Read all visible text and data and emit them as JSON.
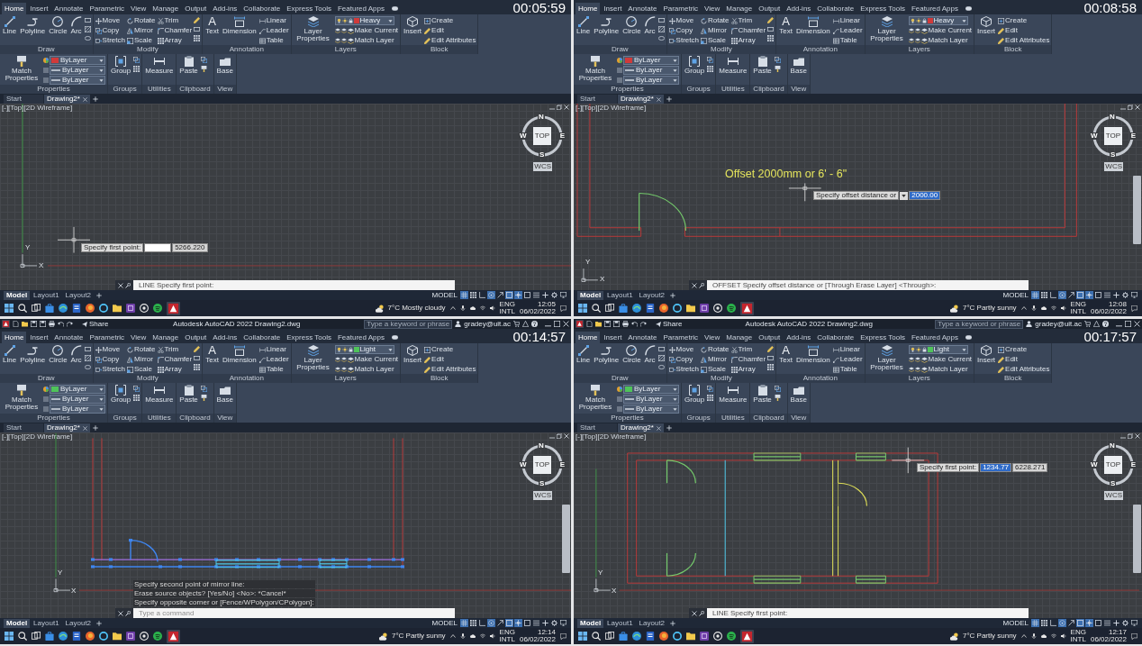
{
  "screens": [
    {
      "timestamp": "00:05:59",
      "ribbon_tabs": [
        {
          "label": "Home",
          "selected": true
        },
        {
          "label": "Insert",
          "selected": false
        },
        {
          "label": "Annotate",
          "selected": false
        },
        {
          "label": "Parametric",
          "selected": false
        },
        {
          "label": "View",
          "selected": false
        },
        {
          "label": "Manage",
          "selected": false
        },
        {
          "label": "Output",
          "selected": false
        },
        {
          "label": "Add-ins",
          "selected": false
        },
        {
          "label": "Collaborate",
          "selected": false
        },
        {
          "label": "Express Tools",
          "selected": false
        },
        {
          "label": "Featured Apps",
          "selected": false
        }
      ],
      "panels": [
        {
          "label": "Draw",
          "tools": [
            {
              "kind": "large",
              "label": "Line"
            },
            {
              "kind": "large",
              "label": "Polyline"
            },
            {
              "kind": "large",
              "label": "Circle"
            },
            {
              "kind": "large",
              "label": "Arc"
            }
          ]
        },
        {
          "label": "Modify",
          "tools": [
            {
              "kind": "small",
              "label": "Move"
            },
            {
              "kind": "small",
              "label": "Copy"
            },
            {
              "kind": "small",
              "label": "Stretch"
            },
            {
              "kind": "small",
              "label": "Rotate"
            },
            {
              "kind": "small",
              "label": "Mirror"
            },
            {
              "kind": "small",
              "label": "Scale"
            },
            {
              "kind": "small",
              "label": "Trim"
            },
            {
              "kind": "small",
              "label": "Chamfer"
            },
            {
              "kind": "small",
              "label": "Array"
            }
          ]
        },
        {
          "label": "Annotation",
          "tools": [
            {
              "kind": "large",
              "label": "Text",
              "glyph": "A"
            },
            {
              "kind": "large",
              "label": "Dimension"
            },
            {
              "kind": "small",
              "label": "Linear"
            },
            {
              "kind": "small",
              "label": "Leader"
            },
            {
              "kind": "small",
              "label": "Table"
            }
          ]
        },
        {
          "label": "Layers",
          "tools": [
            {
              "kind": "large",
              "label": "Layer Properties"
            },
            {
              "kind": "layer",
              "label": "Heavy",
              "color": "#d03a3a"
            },
            {
              "kind": "small",
              "label": "Make Current"
            },
            {
              "kind": "small",
              "label": "Match Layer"
            }
          ]
        },
        {
          "label": "Block",
          "tools": [
            {
              "kind": "large",
              "label": "Insert"
            },
            {
              "kind": "small",
              "label": "Create"
            },
            {
              "kind": "small",
              "label": "Edit"
            },
            {
              "kind": "small",
              "label": "Edit Attributes"
            }
          ]
        },
        {
          "label": "Properties",
          "tools": [
            {
              "kind": "large",
              "label": "Match Properties"
            },
            {
              "kind": "property",
              "label": "ByLayer",
              "color": "#d03a3a"
            },
            {
              "kind": "property",
              "label": "ByLayer"
            },
            {
              "kind": "property",
              "label": "ByLayer"
            }
          ]
        },
        {
          "label": "Groups",
          "tools": [
            {
              "kind": "large",
              "label": "Group"
            }
          ]
        },
        {
          "label": "Utilities",
          "tools": [
            {
              "kind": "large",
              "label": "Measure"
            }
          ]
        },
        {
          "label": "Clipboard",
          "tools": [
            {
              "kind": "large",
              "label": "Paste"
            }
          ]
        },
        {
          "label": "View",
          "tools": [
            {
              "kind": "large",
              "label": "Base"
            }
          ]
        }
      ],
      "file_tabs": [
        {
          "label": "Start",
          "selected": false
        },
        {
          "label": "Drawing2*",
          "selected": true
        }
      ],
      "viewport_label": "[-][Top][2D Wireframe]",
      "viewcube": {
        "face": "TOP",
        "north": "N",
        "south": "S",
        "east": "E",
        "west": "W",
        "ucs": "WCS"
      },
      "navigation_bar": false,
      "ucs_icon": {
        "x": "X",
        "y": "Y"
      },
      "kind": "blank",
      "tooltip": {
        "prompt": "Specify first point:",
        "fields": [
          {
            "selected": false
          },
          {
            "value": "5266.220",
            "selected": false
          }
        ]
      },
      "command_line": {
        "value": "LINE Specify first point:"
      },
      "layout_tabs": [
        {
          "label": "Model",
          "selected": true
        },
        {
          "label": "Layout1",
          "selected": false
        },
        {
          "label": "Layout2",
          "selected": false
        }
      ],
      "status_bar": {
        "mode": "MODEL",
        "toggles": [
          {
            "on": true
          },
          {
            "on": false
          },
          {
            "on": false
          },
          {
            "on": true
          },
          {
            "on": false
          },
          {
            "on": true
          },
          {
            "on": true
          },
          {
            "on": false
          },
          {
            "on": false
          },
          {
            "on": false
          },
          {
            "on": false
          },
          {
            "on": false
          }
        ]
      },
      "taskbar": {
        "weather": "7°C Mostly cloudy",
        "language": "ENG",
        "layout": "INTL",
        "time": "12:05",
        "date": "06/02/2022"
      }
    },
    {
      "timestamp": "00:08:58",
      "ribbon_tabs": [
        {
          "label": "Home",
          "selected": true
        },
        {
          "label": "Insert",
          "selected": false
        },
        {
          "label": "Annotate",
          "selected": false
        },
        {
          "label": "Parametric",
          "selected": false
        },
        {
          "label": "View",
          "selected": false
        },
        {
          "label": "Manage",
          "selected": false
        },
        {
          "label": "Output",
          "selected": false
        },
        {
          "label": "Add-ins",
          "selected": false
        },
        {
          "label": "Collaborate",
          "selected": false
        },
        {
          "label": "Express Tools",
          "selected": false
        },
        {
          "label": "Featured Apps",
          "selected": false
        }
      ],
      "panels": [
        {
          "label": "Draw",
          "tools": [
            {
              "kind": "large",
              "label": "Line"
            },
            {
              "kind": "large",
              "label": "Polyline"
            },
            {
              "kind": "large",
              "label": "Circle"
            },
            {
              "kind": "large",
              "label": "Arc"
            }
          ]
        },
        {
          "label": "Modify",
          "tools": [
            {
              "kind": "small",
              "label": "Move"
            },
            {
              "kind": "small",
              "label": "Copy"
            },
            {
              "kind": "small",
              "label": "Stretch"
            },
            {
              "kind": "small",
              "label": "Rotate"
            },
            {
              "kind": "small",
              "label": "Mirror"
            },
            {
              "kind": "small",
              "label": "Scale"
            },
            {
              "kind": "small",
              "label": "Trim"
            },
            {
              "kind": "small",
              "label": "Chamfer"
            },
            {
              "kind": "small",
              "label": "Array"
            }
          ]
        },
        {
          "label": "Annotation",
          "tools": [
            {
              "kind": "large",
              "label": "Text",
              "glyph": "A"
            },
            {
              "kind": "large",
              "label": "Dimension"
            },
            {
              "kind": "small",
              "label": "Linear"
            },
            {
              "kind": "small",
              "label": "Leader"
            },
            {
              "kind": "small",
              "label": "Table"
            }
          ]
        },
        {
          "label": "Layers",
          "tools": [
            {
              "kind": "large",
              "label": "Layer Properties"
            },
            {
              "kind": "layer",
              "label": "Heavy",
              "color": "#d03a3a"
            },
            {
              "kind": "small",
              "label": "Make Current"
            },
            {
              "kind": "small",
              "label": "Match Layer"
            }
          ]
        },
        {
          "label": "Block",
          "tools": [
            {
              "kind": "large",
              "label": "Insert"
            },
            {
              "kind": "small",
              "label": "Create"
            },
            {
              "kind": "small",
              "label": "Edit"
            },
            {
              "kind": "small",
              "label": "Edit Attributes"
            }
          ]
        },
        {
          "label": "Properties",
          "tools": [
            {
              "kind": "large",
              "label": "Match Properties"
            },
            {
              "kind": "property",
              "label": "ByLayer",
              "color": "#d03a3a"
            },
            {
              "kind": "property",
              "label": "ByLayer"
            },
            {
              "kind": "property",
              "label": "ByLayer"
            }
          ]
        },
        {
          "label": "Groups",
          "tools": [
            {
              "kind": "large",
              "label": "Group"
            }
          ]
        },
        {
          "label": "Utilities",
          "tools": [
            {
              "kind": "large",
              "label": "Measure"
            }
          ]
        },
        {
          "label": "Clipboard",
          "tools": [
            {
              "kind": "large",
              "label": "Paste"
            }
          ]
        },
        {
          "label": "View",
          "tools": [
            {
              "kind": "large",
              "label": "Base"
            }
          ]
        }
      ],
      "file_tabs": [
        {
          "label": "Start",
          "selected": false
        },
        {
          "label": "Drawing2*",
          "selected": true
        }
      ],
      "viewport_label": "[-][Top][2D Wireframe]",
      "viewcube": {
        "face": "TOP",
        "north": "N",
        "south": "S",
        "east": "E",
        "west": "W",
        "ucs": "WCS"
      },
      "navigation_bar": true,
      "ucs_icon": {
        "x": "X",
        "y": "Y"
      },
      "kind": "offset",
      "annotation": "Offset 2000mm or 6' - 6\"",
      "tooltip": {
        "prompt": "Specify offset distance or",
        "has_options": true,
        "fields": [
          {
            "value": "2000.00",
            "selected": true
          }
        ]
      },
      "command_line": {
        "value": "OFFSET Specify offset distance or [Through Erase Layer] <Through>:"
      },
      "layout_tabs": [
        {
          "label": "Model",
          "selected": true
        },
        {
          "label": "Layout1",
          "selected": false
        },
        {
          "label": "Layout2",
          "selected": false
        }
      ],
      "status_bar": {
        "mode": "MODEL",
        "toggles": [
          {
            "on": true
          },
          {
            "on": false
          },
          {
            "on": false
          },
          {
            "on": true
          },
          {
            "on": false
          },
          {
            "on": true
          },
          {
            "on": true
          },
          {
            "on": false
          },
          {
            "on": false
          },
          {
            "on": false
          },
          {
            "on": false
          },
          {
            "on": false
          }
        ]
      },
      "taskbar": {
        "weather": "7°C Partly sunny",
        "language": "ENG",
        "layout": "INTL",
        "time": "12:08",
        "date": "06/02/2022"
      }
    },
    {
      "timestamp": "00:14:57",
      "title_bar": {
        "share": "Share",
        "title": "Autodesk AutoCAD 2022 Drawing2.dwg",
        "search_placeholder": "Type a keyword or phrase",
        "user": "gradey@uit.ac"
      },
      "ribbon_tabs": [
        {
          "label": "Home",
          "selected": true
        },
        {
          "label": "Insert",
          "selected": false
        },
        {
          "label": "Annotate",
          "selected": false
        },
        {
          "label": "Parametric",
          "selected": false
        },
        {
          "label": "View",
          "selected": false
        },
        {
          "label": "Manage",
          "selected": false
        },
        {
          "label": "Output",
          "selected": false
        },
        {
          "label": "Add-ins",
          "selected": false
        },
        {
          "label": "Collaborate",
          "selected": false
        },
        {
          "label": "Express Tools",
          "selected": false
        },
        {
          "label": "Featured Apps",
          "selected": false
        }
      ],
      "panels": [
        {
          "label": "Draw",
          "tools": [
            {
              "kind": "large",
              "label": "Line"
            },
            {
              "kind": "large",
              "label": "Polyline"
            },
            {
              "kind": "large",
              "label": "Circle"
            },
            {
              "kind": "large",
              "label": "Arc"
            }
          ]
        },
        {
          "label": "Modify",
          "tools": [
            {
              "kind": "small",
              "label": "Move"
            },
            {
              "kind": "small",
              "label": "Copy"
            },
            {
              "kind": "small",
              "label": "Stretch"
            },
            {
              "kind": "small",
              "label": "Rotate"
            },
            {
              "kind": "small",
              "label": "Mirror"
            },
            {
              "kind": "small",
              "label": "Scale"
            },
            {
              "kind": "small",
              "label": "Trim"
            },
            {
              "kind": "small",
              "label": "Chamfer"
            },
            {
              "kind": "small",
              "label": "Array"
            }
          ]
        },
        {
          "label": "Annotation",
          "tools": [
            {
              "kind": "large",
              "label": "Text",
              "glyph": "A"
            },
            {
              "kind": "large",
              "label": "Dimension"
            },
            {
              "kind": "small",
              "label": "Linear"
            },
            {
              "kind": "small",
              "label": "Leader"
            },
            {
              "kind": "small",
              "label": "Table"
            }
          ]
        },
        {
          "label": "Layers",
          "tools": [
            {
              "kind": "large",
              "label": "Layer Properties"
            },
            {
              "kind": "layer",
              "label": "Light",
              "color": "#4fc35a"
            },
            {
              "kind": "small",
              "label": "Make Current"
            },
            {
              "kind": "small",
              "label": "Match Layer"
            }
          ]
        },
        {
          "label": "Block",
          "tools": [
            {
              "kind": "large",
              "label": "Insert"
            },
            {
              "kind": "small",
              "label": "Create"
            },
            {
              "kind": "small",
              "label": "Edit"
            },
            {
              "kind": "small",
              "label": "Edit Attributes"
            }
          ]
        },
        {
          "label": "Properties",
          "tools": [
            {
              "kind": "large",
              "label": "Match Properties"
            },
            {
              "kind": "property",
              "label": "ByLayer",
              "color": "#4fc35a"
            },
            {
              "kind": "property",
              "label": "ByLayer"
            },
            {
              "kind": "property",
              "label": "ByLayer"
            }
          ]
        },
        {
          "label": "Groups",
          "tools": [
            {
              "kind": "large",
              "label": "Group"
            }
          ]
        },
        {
          "label": "Utilities",
          "tools": [
            {
              "kind": "large",
              "label": "Measure"
            }
          ]
        },
        {
          "label": "Clipboard",
          "tools": [
            {
              "kind": "large",
              "label": "Paste"
            }
          ]
        },
        {
          "label": "View",
          "tools": [
            {
              "kind": "large",
              "label": "Base"
            }
          ]
        }
      ],
      "file_tabs": [
        {
          "label": "Start",
          "selected": false
        },
        {
          "label": "Drawing2*",
          "selected": true
        }
      ],
      "viewport_label": "[-][Top][2D Wireframe]",
      "viewcube": {
        "face": "TOP",
        "north": "N",
        "south": "S",
        "east": "E",
        "west": "W",
        "ucs": "WCS"
      },
      "navigation_bar": true,
      "ucs_icon": {
        "x": "X",
        "y": "Y"
      },
      "kind": "mirror",
      "command_history": [
        "Specify second point of mirror line:",
        "Erase source objects? [Yes/No] <No>: *Cancel*",
        "Specify opposite corner or [Fence/WPolygon/CPolygon]:"
      ],
      "command_line": {
        "placeholder": "Type a command"
      },
      "layout_tabs": [
        {
          "label": "Model",
          "selected": true
        },
        {
          "label": "Layout1",
          "selected": false
        },
        {
          "label": "Layout2",
          "selected": false
        }
      ],
      "status_bar": {
        "mode": "MODEL",
        "toggles": [
          {
            "on": true
          },
          {
            "on": false
          },
          {
            "on": false
          },
          {
            "on": true
          },
          {
            "on": false
          },
          {
            "on": true
          },
          {
            "on": true
          },
          {
            "on": false
          },
          {
            "on": false
          },
          {
            "on": false
          },
          {
            "on": false
          },
          {
            "on": false
          }
        ]
      },
      "taskbar": {
        "weather": "7°C Partly sunny",
        "language": "ENG",
        "layout": "INTL",
        "time": "12:14",
        "date": "06/02/2022"
      }
    },
    {
      "timestamp": "00:17:57",
      "title_bar": {
        "share": "Share",
        "title": "Autodesk AutoCAD 2022 Drawing2.dwg",
        "search_placeholder": "Type a keyword or phrase",
        "user": "gradey@uit.ac"
      },
      "ribbon_tabs": [
        {
          "label": "Home",
          "selected": true
        },
        {
          "label": "Insert",
          "selected": false
        },
        {
          "label": "Annotate",
          "selected": false
        },
        {
          "label": "Parametric",
          "selected": false
        },
        {
          "label": "View",
          "selected": false
        },
        {
          "label": "Manage",
          "selected": false
        },
        {
          "label": "Output",
          "selected": false
        },
        {
          "label": "Add-ins",
          "selected": false
        },
        {
          "label": "Collaborate",
          "selected": false
        },
        {
          "label": "Express Tools",
          "selected": false
        },
        {
          "label": "Featured Apps",
          "selected": false
        }
      ],
      "panels": [
        {
          "label": "Draw",
          "tools": [
            {
              "kind": "large",
              "label": "Line"
            },
            {
              "kind": "large",
              "label": "Polyline"
            },
            {
              "kind": "large",
              "label": "Circle"
            },
            {
              "kind": "large",
              "label": "Arc"
            }
          ]
        },
        {
          "label": "Modify",
          "tools": [
            {
              "kind": "small",
              "label": "Move"
            },
            {
              "kind": "small",
              "label": "Copy"
            },
            {
              "kind": "small",
              "label": "Stretch"
            },
            {
              "kind": "small",
              "label": "Rotate"
            },
            {
              "kind": "small",
              "label": "Mirror"
            },
            {
              "kind": "small",
              "label": "Scale"
            },
            {
              "kind": "small",
              "label": "Trim"
            },
            {
              "kind": "small",
              "label": "Chamfer"
            },
            {
              "kind": "small",
              "label": "Array"
            }
          ]
        },
        {
          "label": "Annotation",
          "tools": [
            {
              "kind": "large",
              "label": "Text",
              "glyph": "A"
            },
            {
              "kind": "large",
              "label": "Dimension"
            },
            {
              "kind": "small",
              "label": "Linear"
            },
            {
              "kind": "small",
              "label": "Leader"
            },
            {
              "kind": "small",
              "label": "Table"
            }
          ]
        },
        {
          "label": "Layers",
          "tools": [
            {
              "kind": "large",
              "label": "Layer Properties"
            },
            {
              "kind": "layer",
              "label": "Light",
              "color": "#4fc35a"
            },
            {
              "kind": "small",
              "label": "Make Current"
            },
            {
              "kind": "small",
              "label": "Match Layer"
            }
          ]
        },
        {
          "label": "Block",
          "tools": [
            {
              "kind": "large",
              "label": "Insert"
            },
            {
              "kind": "small",
              "label": "Create"
            },
            {
              "kind": "small",
              "label": "Edit"
            },
            {
              "kind": "small",
              "label": "Edit Attributes"
            }
          ]
        },
        {
          "label": "Properties",
          "tools": [
            {
              "kind": "large",
              "label": "Match Properties"
            },
            {
              "kind": "property",
              "label": "ByLayer",
              "color": "#4fc35a"
            },
            {
              "kind": "property",
              "label": "ByLayer"
            },
            {
              "kind": "property",
              "label": "ByLayer"
            }
          ]
        },
        {
          "label": "Groups",
          "tools": [
            {
              "kind": "large",
              "label": "Group"
            }
          ]
        },
        {
          "label": "Utilities",
          "tools": [
            {
              "kind": "large",
              "label": "Measure"
            }
          ]
        },
        {
          "label": "Clipboard",
          "tools": [
            {
              "kind": "large",
              "label": "Paste"
            }
          ]
        },
        {
          "label": "View",
          "tools": [
            {
              "kind": "large",
              "label": "Base"
            }
          ]
        }
      ],
      "file_tabs": [
        {
          "label": "Start",
          "selected": false
        },
        {
          "label": "Drawing2*",
          "selected": true
        }
      ],
      "viewport_label": "[-][Top][2D Wireframe]",
      "viewcube": {
        "face": "TOP",
        "north": "N",
        "south": "S",
        "east": "E",
        "west": "W",
        "ucs": "WCS"
      },
      "navigation_bar": true,
      "ucs_icon": {
        "x": "X",
        "y": "Y"
      },
      "kind": "plan",
      "tooltip": {
        "prompt": "Specify first point:",
        "fields": [
          {
            "value": "1234.77",
            "selected": true
          },
          {
            "value": "6228.271",
            "selected": false
          }
        ]
      },
      "command_line": {
        "value": "LINE Specify first point:"
      },
      "layout_tabs": [
        {
          "label": "Model",
          "selected": true
        },
        {
          "label": "Layout1",
          "selected": false
        },
        {
          "label": "Layout2",
          "selected": false
        }
      ],
      "status_bar": {
        "mode": "MODEL",
        "toggles": [
          {
            "on": true
          },
          {
            "on": false
          },
          {
            "on": false
          },
          {
            "on": true
          },
          {
            "on": false
          },
          {
            "on": true
          },
          {
            "on": true
          },
          {
            "on": false
          },
          {
            "on": false
          },
          {
            "on": false
          },
          {
            "on": false
          },
          {
            "on": false
          }
        ]
      },
      "taskbar": {
        "weather": "7°C Partly sunny",
        "language": "ENG",
        "layout": "INTL",
        "time": "12:17",
        "date": "06/02/2022"
      }
    }
  ]
}
